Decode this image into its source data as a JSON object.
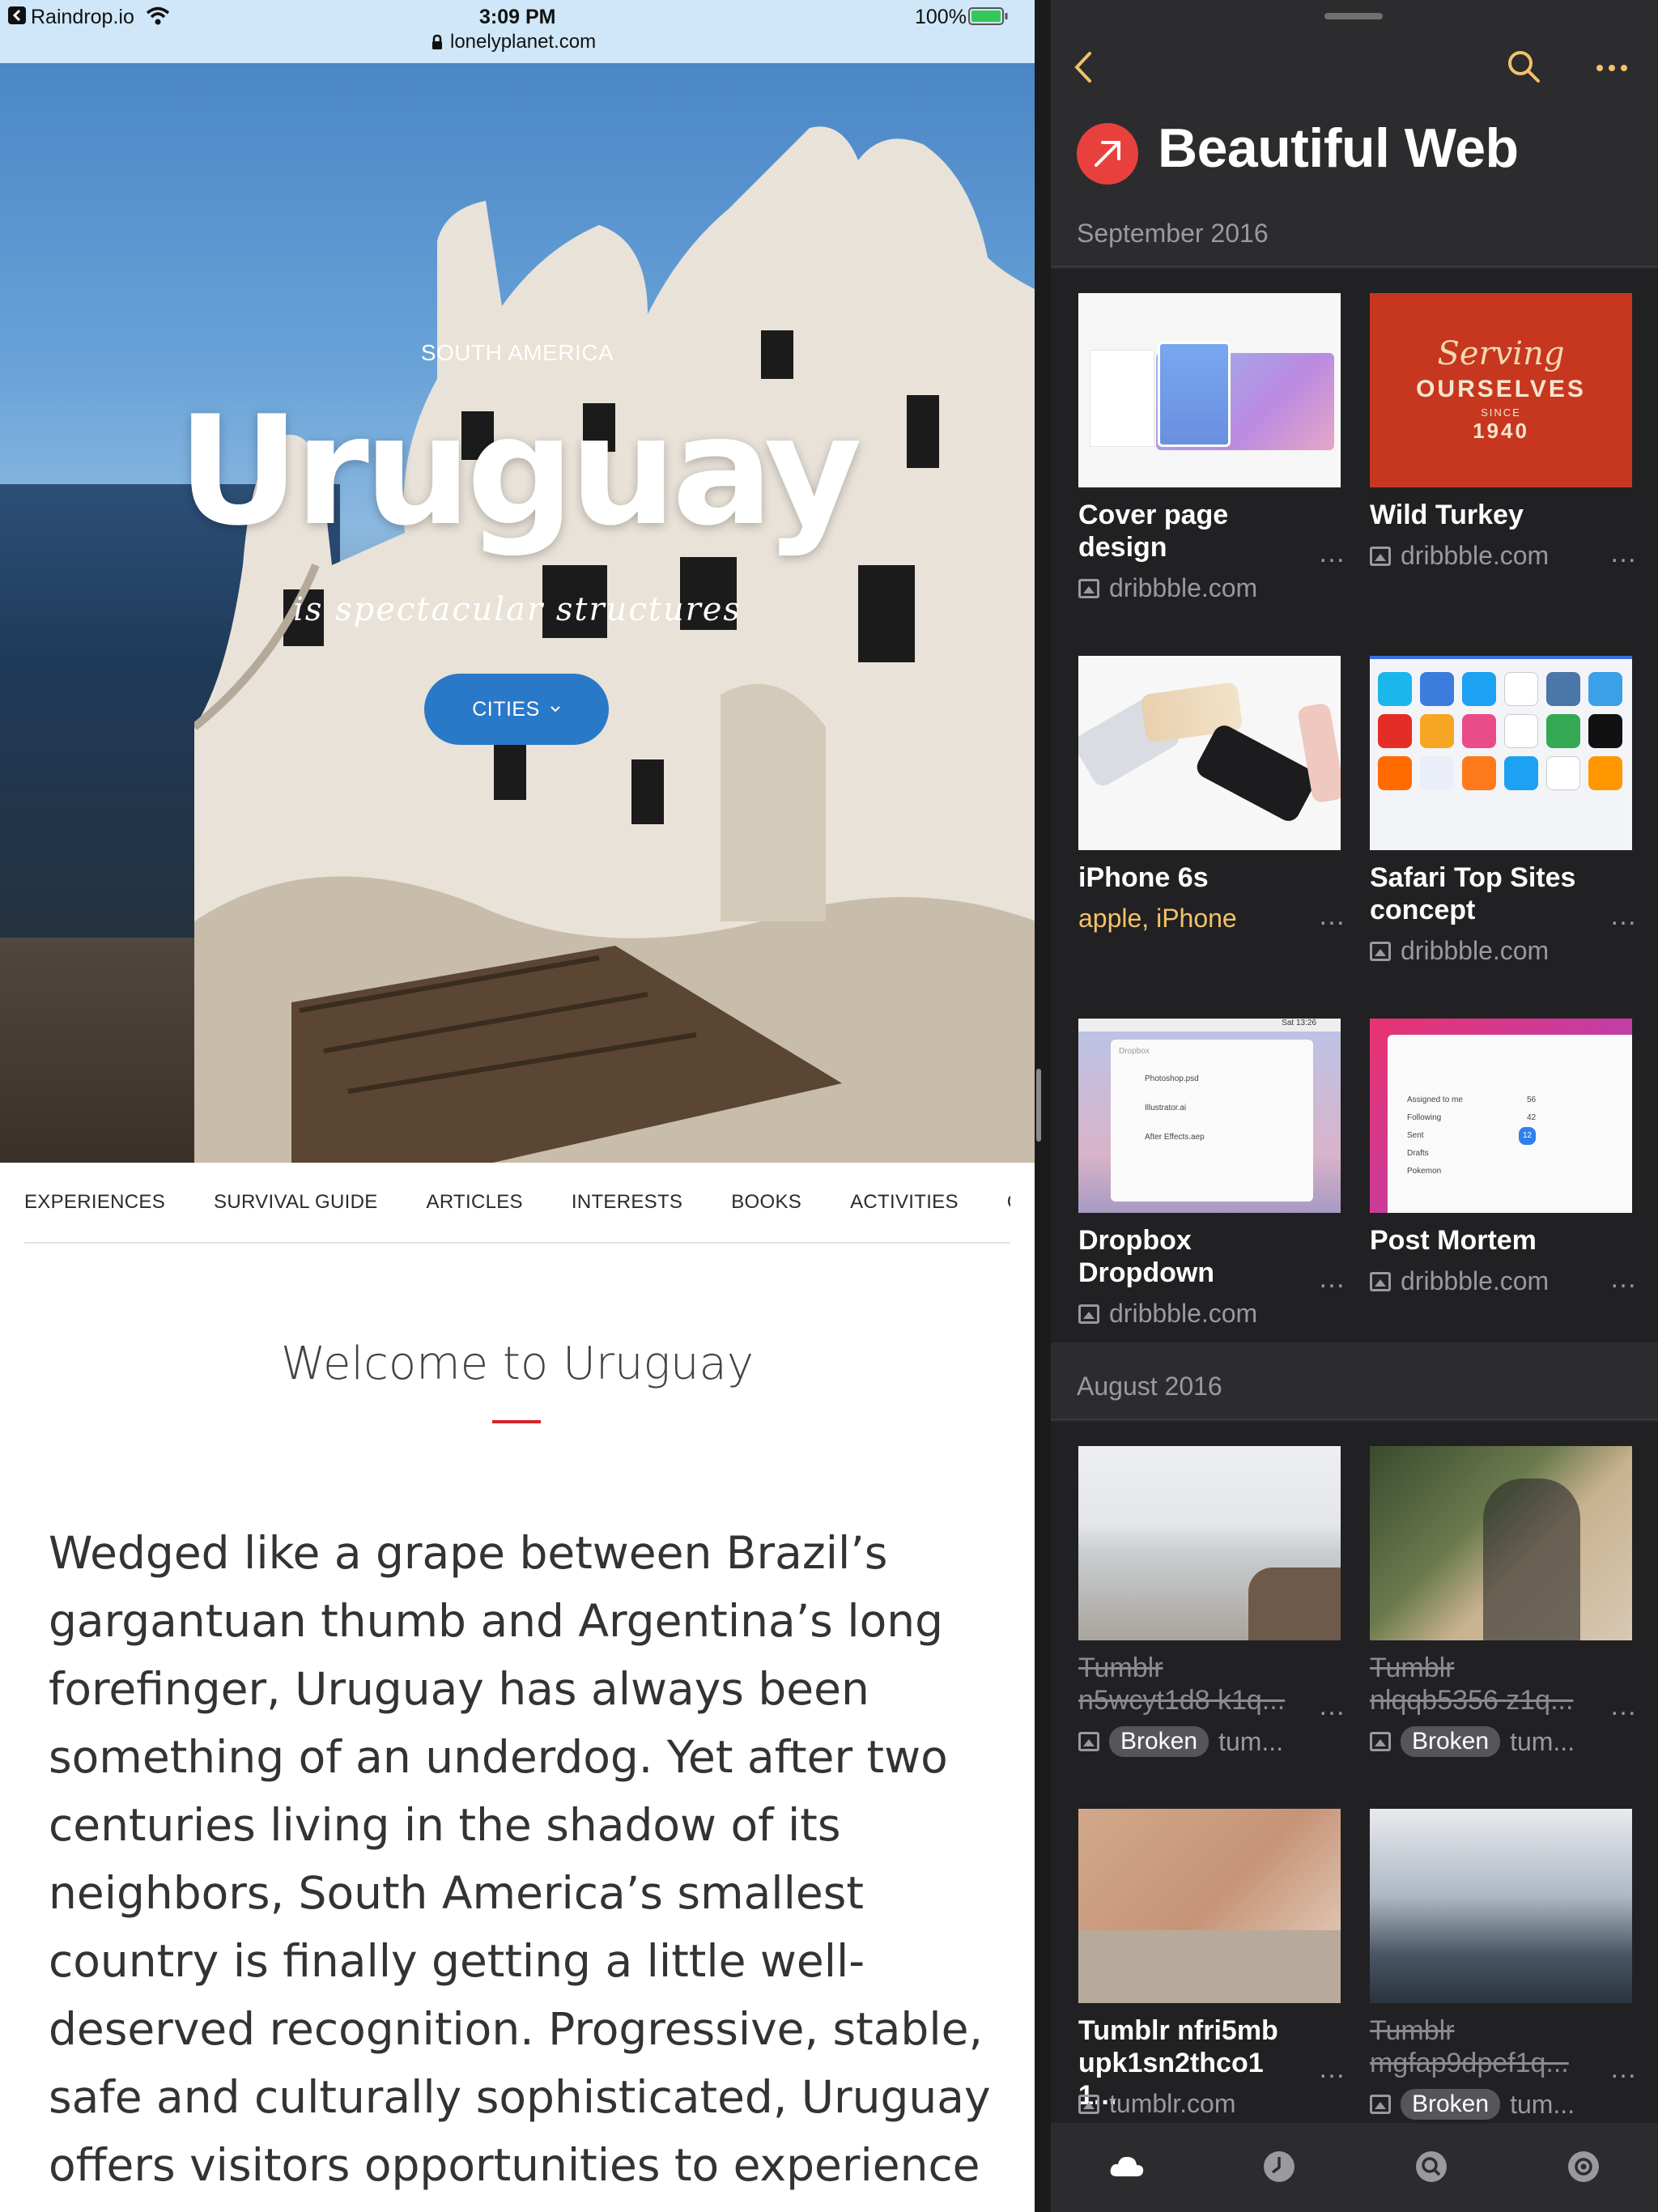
{
  "status_bar": {
    "back_app": "Raindrop.io",
    "time": "3:09 PM",
    "url": "lonelyplanet.com",
    "battery": "100%"
  },
  "hero": {
    "kicker": "SOUTH AMERICA",
    "title": "Uruguay",
    "subtitle": "is spectacular structures",
    "cta": "CITIES"
  },
  "subnav": [
    "EXPERIENCES",
    "SURVIVAL GUIDE",
    "ARTICLES",
    "INTERESTS",
    "BOOKS",
    "ACTIVITIES",
    "CO"
  ],
  "article": {
    "heading": "Welcome to Uruguay",
    "body": "Wedged like a grape between Brazil’s gargantuan thumb and Argentina’s long forefinger, Uruguay has always been something of an underdog. Yet after two centuries living in the shadow of its neighbors, South America’s smallest country is finally getting a little well-deserved recognition. Progressive, stable, safe and culturally sophisticated, Uruguay offers visitors opportunities to experience everyday ‘not"
  },
  "raindrop": {
    "collection_title": "Beautiful Web",
    "sections": [
      {
        "label": "September 2016",
        "cards": [
          {
            "title": "Cover page design",
            "meta": "dribbble.com",
            "meta_type": "domain"
          },
          {
            "title": "Wild Turkey",
            "meta": "dribbble.com",
            "meta_type": "domain",
            "thumb_text_1": "Serving",
            "thumb_text_2": "OURSELVES",
            "thumb_text_3": "SINCE",
            "thumb_text_4": "1940"
          },
          {
            "title": "iPhone 6s",
            "meta": "apple, iPhone",
            "meta_type": "tags"
          },
          {
            "title": "Safari Top Sites concept",
            "meta": "dribbble.com",
            "meta_type": "domain"
          },
          {
            "title": "Dropbox Dropdown",
            "meta": "dribbble.com",
            "meta_type": "domain",
            "thumb_text_1": "Sat 13:26",
            "thumb_text_2": "Dropbox",
            "thumb_text_3": "Photoshop.psd",
            "thumb_text_4": "Illustrator.ai",
            "thumb_text_5": "After Effects.aep"
          },
          {
            "title": "Post Mortem",
            "meta": "dribbble.com",
            "meta_type": "domain",
            "thumb_text_1": "Assigned to me",
            "thumb_text_2": "Following",
            "thumb_text_3": "Sent",
            "thumb_text_4": "Drafts",
            "thumb_text_5": "Pokemon",
            "thumb_text_6": "56",
            "thumb_text_7": "42",
            "thumb_text_8": "12"
          }
        ]
      },
      {
        "label": "August 2016",
        "cards": [
          {
            "title": "Tumblr n5wcyt1d8 k1q...",
            "meta": "tum...",
            "badge": "Broken",
            "broken": true
          },
          {
            "title": "Tumblr nlqqb5356 z1q...",
            "meta": "tum...",
            "badge": "Broken",
            "broken": true
          },
          {
            "title": "Tumblr nfri5mb upk1sn2thco1 1...",
            "meta": "tumblr.com",
            "broken": false
          },
          {
            "title": "Tumblr mgfap9dpef1q...",
            "meta": "tum...",
            "badge": "Broken",
            "broken": true
          }
        ]
      }
    ],
    "more_glyph": "…",
    "tabs": [
      "cloud-icon",
      "clock-icon",
      "search-icon",
      "settings-icon"
    ],
    "colors": {
      "accent": "#e8413d",
      "tag": "#f2c26a",
      "cta": "#2a79c8",
      "rule": "#d7262b"
    }
  }
}
